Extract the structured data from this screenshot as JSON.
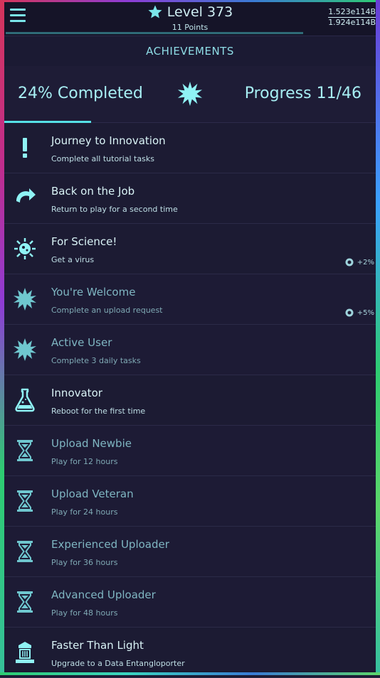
{
  "header": {
    "level": "Level 373",
    "points": "11 Points",
    "currency_top": "1.523e114B",
    "currency_bottom": "1.924e114B"
  },
  "section_title": "ACHIEVEMENTS",
  "summary": {
    "completed": "24% Completed",
    "progress": "Progress 11/46",
    "completion_fraction": 0.24
  },
  "achievements": [
    {
      "title": "Journey to Innovation",
      "desc": "Complete all tutorial tasks",
      "icon": "exclamation-icon",
      "state": "done",
      "reward": ""
    },
    {
      "title": "Back on the Job",
      "desc": "Return to play for a second time",
      "icon": "return-arrow-icon",
      "state": "done",
      "reward": ""
    },
    {
      "title": "For Science!",
      "desc": "Get a virus",
      "icon": "virus-icon",
      "state": "done",
      "reward": "+2%"
    },
    {
      "title": "You're Welcome",
      "desc": "Complete an upload request",
      "icon": "burst-icon",
      "state": "dim",
      "reward": "+5%"
    },
    {
      "title": "Active User",
      "desc": "Complete 3 daily tasks",
      "icon": "burst-icon",
      "state": "dim",
      "reward": ""
    },
    {
      "title": "Innovator",
      "desc": "Reboot for the first time",
      "icon": "flask-icon",
      "state": "done",
      "reward": ""
    },
    {
      "title": "Upload Newbie",
      "desc": "Play for 12 hours",
      "icon": "hourglass-icon",
      "state": "dim",
      "reward": ""
    },
    {
      "title": "Upload Veteran",
      "desc": "Play for 24 hours",
      "icon": "hourglass-icon",
      "state": "dim",
      "reward": ""
    },
    {
      "title": "Experienced Uploader",
      "desc": "Play for 36 hours",
      "icon": "hourglass-icon",
      "state": "dim",
      "reward": ""
    },
    {
      "title": "Advanced Uploader",
      "desc": "Play for 48 hours",
      "icon": "hourglass-icon",
      "state": "dim",
      "reward": ""
    },
    {
      "title": "Faster Than Light",
      "desc": "Upgrade to a Data Entangloporter",
      "icon": "teleporter-icon",
      "state": "done",
      "reward": ""
    }
  ],
  "colors": {
    "accent": "#56e0e6",
    "background": "#1c1b33"
  }
}
